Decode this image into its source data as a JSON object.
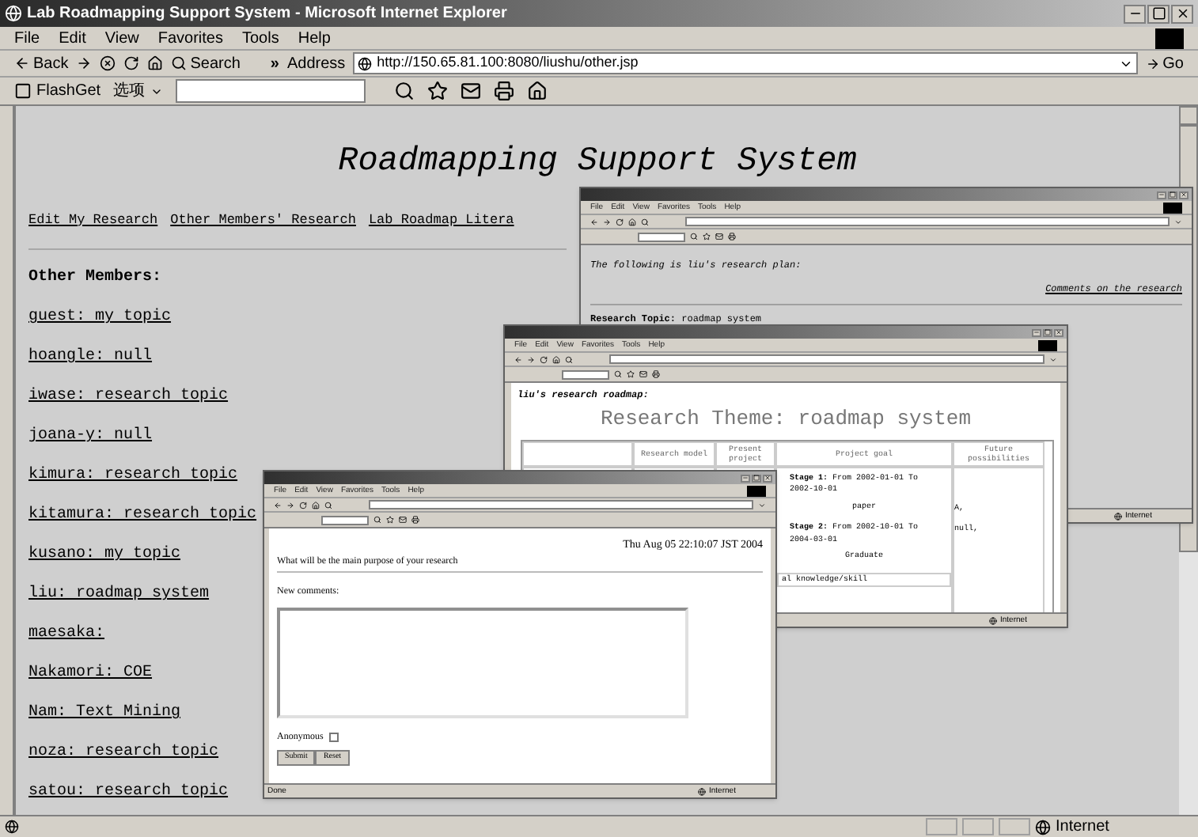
{
  "window": {
    "title": "Lab Roadmapping Support System - Microsoft Internet Explorer"
  },
  "menu": [
    "File",
    "Edit",
    "View",
    "Favorites",
    "Tools",
    "Help"
  ],
  "toolbar": {
    "back": "Back",
    "search": "Search",
    "more": "»",
    "address_label": "Address",
    "address": "http://150.65.81.100:8080/liushu/other.jsp",
    "go": "Go"
  },
  "flashget": {
    "label": "FlashGet",
    "options": "选项"
  },
  "page": {
    "heading": "Roadmapping Support System",
    "nav": [
      "Edit My Research",
      "Other Members' Research",
      "Lab Roadmap Litera"
    ],
    "members_heading": "Other Members:",
    "members": [
      "guest: my topic",
      "hoangle: null",
      "iwase: research topic",
      "joana-y: null",
      "kimura: research topic",
      "kitamura: research topic",
      "kusano: my topic",
      "liu: roadmap system",
      "maesaka:",
      "Nakamori: COE",
      "Nam: Text Mining",
      "noza: research topic",
      "satou: research topic"
    ]
  },
  "plan_window": {
    "menu": [
      "File",
      "Edit",
      "View",
      "Favorites",
      "Tools",
      "Help"
    ],
    "intro": "The following is liu's research plan:",
    "comments_link": "Comments on the research",
    "topic": "**Research Topic:** roadmap system",
    "status": "Internet"
  },
  "roadmap_window": {
    "menu": [
      "File",
      "Edit",
      "View",
      "Favorites",
      "Tools",
      "Help"
    ],
    "caption": "liu's research roadmap:",
    "theme": "Research Theme: roadmap system",
    "columns": [
      "Research model",
      "Present project",
      "Project goal",
      "Future possibilities"
    ],
    "goal": [
      "**Stage 1:** From 2002-01-01 To 2002-10-01",
      "paper",
      "**Stage 2:** From 2002-10-01 To 2004-03-01",
      "Graduate"
    ],
    "skill": "al knowledge/skill",
    "future": [
      "A,",
      "null,"
    ],
    "status": "Internet"
  },
  "comments_window": {
    "menu": [
      "File",
      "Edit",
      "View",
      "Favorites",
      "Tools",
      "Help"
    ],
    "date": "Thu Aug 05 22:10:07 JST 2004",
    "question": "What will be the main purpose of your research",
    "new_comments": "New comments:",
    "anonymous": {
      "label": "Anonymous",
      "checked": false
    },
    "buttons": [
      "Submit",
      "Reset"
    ],
    "status": "Done",
    "zone": "Internet"
  },
  "status_bar": {
    "zone": "Internet"
  }
}
